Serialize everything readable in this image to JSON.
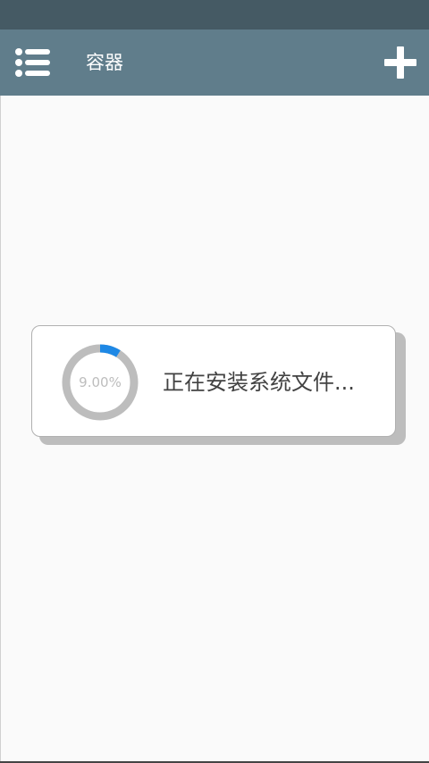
{
  "app_bar": {
    "title": "容器",
    "menu_icon": "list-menu-icon",
    "add_icon": "plus-icon",
    "colors": {
      "status_bar": "#455a64",
      "app_bar": "#607d8b"
    }
  },
  "dialog": {
    "message": "正在安装系统文件...",
    "progress": {
      "label": "9.00%",
      "fraction": 0.09,
      "track_color": "#bdbdbd",
      "fill_color": "#1e88e5"
    }
  }
}
